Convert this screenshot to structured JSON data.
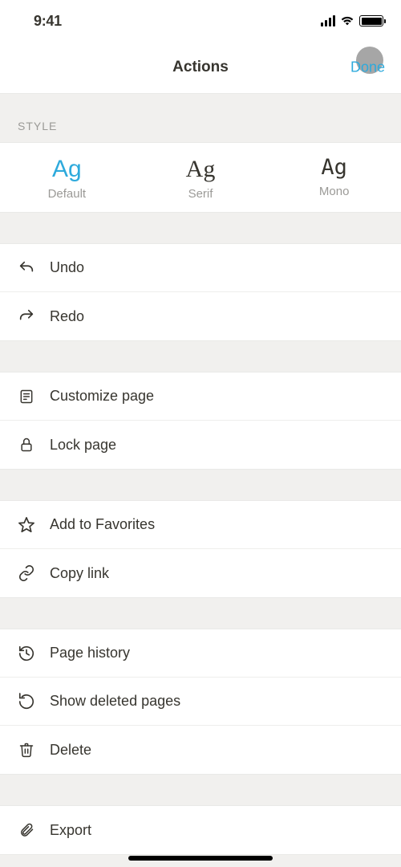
{
  "status": {
    "time": "9:41"
  },
  "header": {
    "title": "Actions",
    "done": "Done"
  },
  "style": {
    "section_label": "STYLE",
    "options": [
      {
        "sample": "Ag",
        "label": "Default"
      },
      {
        "sample": "Ag",
        "label": "Serif"
      },
      {
        "sample": "Ag",
        "label": "Mono"
      }
    ]
  },
  "groups": {
    "history": {
      "undo": "Undo",
      "redo": "Redo"
    },
    "page": {
      "customize": "Customize page",
      "lock": "Lock page"
    },
    "share": {
      "favorite": "Add to Favorites",
      "copy_link": "Copy link"
    },
    "manage": {
      "history": "Page history",
      "deleted": "Show deleted pages",
      "delete": "Delete"
    },
    "export": {
      "export": "Export"
    }
  }
}
